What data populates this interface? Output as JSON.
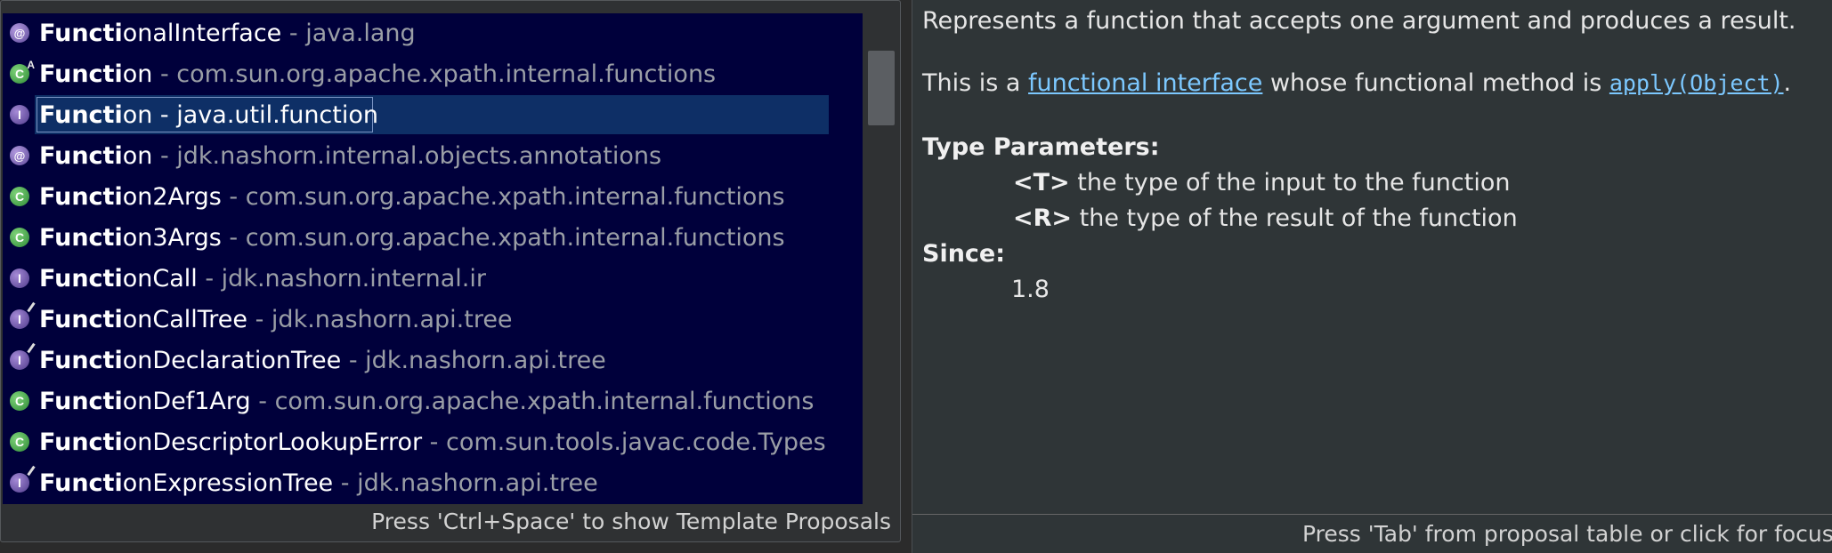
{
  "proposals": [
    {
      "match": "Functi",
      "rest": "onalInterface",
      "qualifier": " - java.lang",
      "icon": "annotation-icon",
      "selected": false
    },
    {
      "match": "Functi",
      "rest": "on",
      "qualifier": " - com.sun.org.apache.xpath.internal.functions",
      "icon": "abstract-class-icon",
      "selected": false
    },
    {
      "match": "Functi",
      "rest": "on - java.util.function",
      "qualifier": "",
      "icon": "interface-icon",
      "selected": true
    },
    {
      "match": "Functi",
      "rest": "on",
      "qualifier": " - jdk.nashorn.internal.objects.annotations",
      "icon": "annotation-icon",
      "selected": false
    },
    {
      "match": "Functi",
      "rest": "on2Args",
      "qualifier": " - com.sun.org.apache.xpath.internal.functions",
      "icon": "class-icon",
      "selected": false
    },
    {
      "match": "Functi",
      "rest": "on3Args",
      "qualifier": " - com.sun.org.apache.xpath.internal.functions",
      "icon": "class-icon",
      "selected": false
    },
    {
      "match": "Functi",
      "rest": "onCall",
      "qualifier": " - jdk.nashorn.internal.ir",
      "icon": "interface-icon",
      "selected": false
    },
    {
      "match": "Functi",
      "rest": "onCallTree",
      "qualifier": " - jdk.nashorn.api.tree",
      "icon": "deprecated-interface-icon",
      "selected": false
    },
    {
      "match": "Functi",
      "rest": "onDeclarationTree",
      "qualifier": " - jdk.nashorn.api.tree",
      "icon": "deprecated-interface-icon",
      "selected": false
    },
    {
      "match": "Functi",
      "rest": "onDef1Arg",
      "qualifier": " - com.sun.org.apache.xpath.internal.functions",
      "icon": "class-icon",
      "selected": false
    },
    {
      "match": "Functi",
      "rest": "onDescriptorLookupError",
      "qualifier": " - com.sun.tools.javac.code.Types",
      "icon": "class-icon",
      "selected": false
    },
    {
      "match": "Functi",
      "rest": "onExpressionTree",
      "qualifier": " - jdk.nashorn.api.tree",
      "icon": "deprecated-interface-icon",
      "selected": false
    }
  ],
  "popup_status": "Press 'Ctrl+Space' to show Template Proposals",
  "doc": {
    "summary": "Represents a function that accepts one argument and produces a result.",
    "fi_prefix": "This is a ",
    "fi_link": "functional interface",
    "fi_middle": " whose functional method is ",
    "fi_method": "apply(Object)",
    "fi_suffix": ".",
    "type_params_heading": "Type Parameters:",
    "type_params": [
      {
        "name": "<T>",
        "desc": " the type of the input to the function"
      },
      {
        "name": "<R>",
        "desc": " the type of the result of the function"
      }
    ],
    "since_heading": "Since:",
    "since_value": "1.8",
    "footer": "Press 'Tab' from proposal table or click for focus"
  },
  "colors": {
    "list_background": "#00003b",
    "selection": "#0e2f66",
    "qualifier": "#9a9ea6",
    "link": "#7cc8ff",
    "doc_background": "#2f3537"
  }
}
